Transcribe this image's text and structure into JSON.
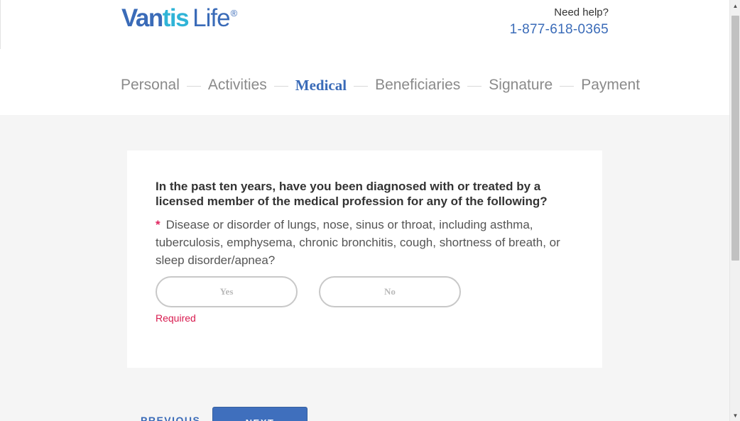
{
  "brand": {
    "logo_part1": "Van",
    "logo_part2": "tis",
    "logo_part3": "Life",
    "logo_reg": "®"
  },
  "help": {
    "label": "Need help?",
    "phone": "1-877-618-0365"
  },
  "steps": [
    {
      "label": "Personal",
      "active": false
    },
    {
      "label": "Activities",
      "active": false
    },
    {
      "label": "Medical",
      "active": true
    },
    {
      "label": "Beneficiaries",
      "active": false
    },
    {
      "label": "Signature",
      "active": false
    },
    {
      "label": "Payment",
      "active": false
    }
  ],
  "form": {
    "question": "In the past ten years, have you been diagnosed with or treated by a licensed member of the medical profession for any of the following?",
    "required_marker": "*",
    "item_text": "Disease or disorder of lungs, nose, sinus or throat, including asthma, tuberculosis, emphysema, chronic bronchitis, cough, shortness of breath, or sleep disorder/apnea?",
    "yes_label": "Yes",
    "no_label": "No",
    "error": "Required"
  },
  "nav": {
    "previous_label": "PREVIOUS",
    "next_label": "NEXT"
  },
  "colors": {
    "brand_blue": "#3a6bb8",
    "brand_cyan": "#2fb4d7",
    "error_red": "#d81b4f",
    "background": "#f5f5f5"
  },
  "icons": {
    "scroll_up": "triangle-up",
    "scroll_down": "triangle-down"
  }
}
